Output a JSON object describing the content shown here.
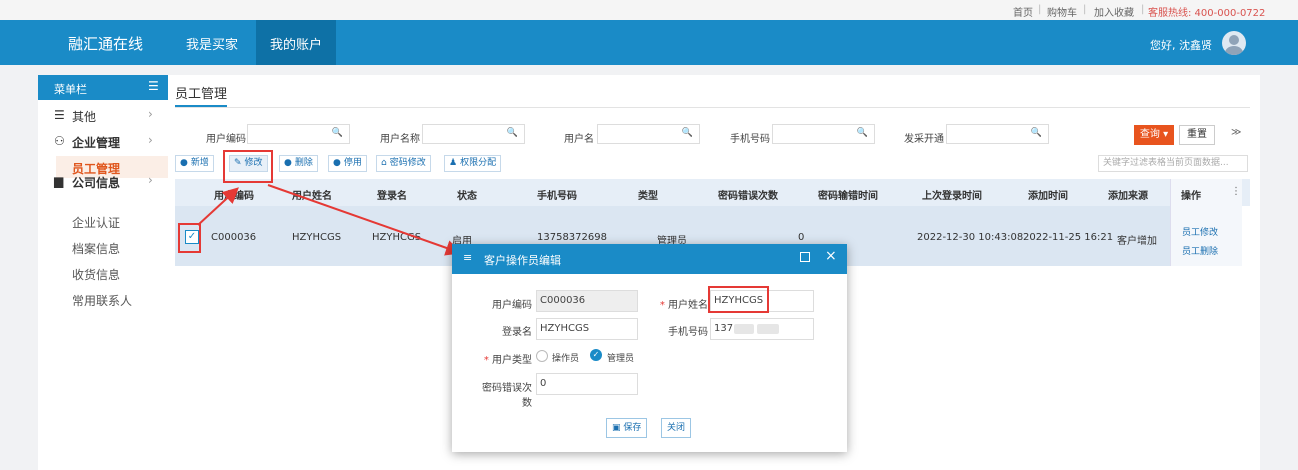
{
  "toplinks": {
    "home": "首页",
    "cart": "购物车",
    "favorite": "加入收藏",
    "hotline": "客服热线: 400-000-0722"
  },
  "nav": {
    "brand": "融汇通在线",
    "buyer": "我是买家",
    "account": "我的账户",
    "greeting": "您好, 沈鑫贤"
  },
  "sidebar": {
    "title": "菜单栏",
    "groups": [
      {
        "label": "其他"
      },
      {
        "label": "企业管理"
      },
      {
        "label": "公司信息"
      }
    ],
    "company_items": [
      "员工管理"
    ],
    "info_items": [
      "企业认证",
      "档案信息",
      "收货信息",
      "常用联系人"
    ]
  },
  "page": {
    "tab": "员工管理"
  },
  "filters": {
    "code": "用户编码",
    "name": "用户名称",
    "username": "用户名",
    "phone": "手机号码",
    "opened": "发采开通",
    "query": "查询",
    "reset": "重置"
  },
  "toolbar": {
    "add": "新增",
    "edit": "修改",
    "del": "删除",
    "disable": "停用",
    "pwd": "密码修改",
    "perm": "权限分配",
    "keyword_placeholder": "关键字过滤表格当前页面数据..."
  },
  "table": {
    "headers": [
      "用户编码",
      "用户姓名",
      "登录名",
      "状态",
      "手机号码",
      "类型",
      "密码错误次数",
      "密码输错时间",
      "上次登录时间",
      "添加时间",
      "添加来源",
      "操作"
    ],
    "row": {
      "code": "C000036",
      "name": "HZYHCGS",
      "login": "HZYHCGS",
      "status": "启用",
      "phone": "13758372698",
      "type": "管理员",
      "errors": "0",
      "last_login": "2022-12-30 10:43:08",
      "added": "2022-11-25 16:21",
      "source": "客户增加"
    },
    "ops": [
      "员工修改",
      "员工删除"
    ]
  },
  "dialog": {
    "title": "客户操作员编辑",
    "code_label": "用户编码",
    "code": "C000036",
    "name_label": "用户姓名",
    "name": "HZYHCGS",
    "login_label": "登录名",
    "login": "HZYHCGS",
    "phone_label": "手机号码",
    "phone": "137",
    "type_label": "用户类型",
    "type_operator": "操作员",
    "type_admin": "管理员",
    "errors_label": "密码错误次数",
    "errors": "0",
    "save": "保存",
    "close": "关闭"
  },
  "colors": {
    "primary": "#1a8bc7",
    "accent": "#e8541e",
    "highlight": "#e53935"
  }
}
